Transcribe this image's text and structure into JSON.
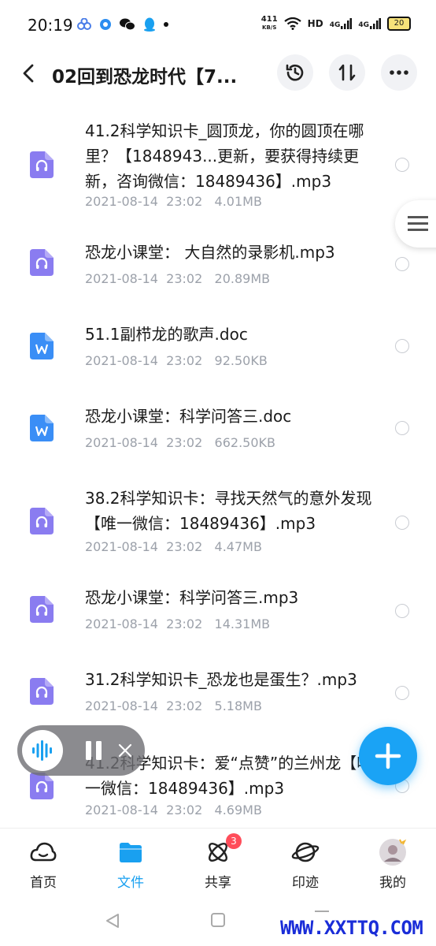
{
  "status_bar": {
    "time": "20:19",
    "net_speed_value": "411",
    "net_speed_unit": "KB/S",
    "hd_label": "HD",
    "signal1": "4G",
    "signal2": "4G",
    "battery": "20"
  },
  "header": {
    "title": "02回到恐龙时代【7..."
  },
  "files": [
    {
      "name": "41.2科学知识卡_圆顶龙，你的圆顶在哪里？【1848943...更新，要获得持续更新，咨询微信：18489436】.mp3",
      "meta": "2021-08-14  23:02   4.01MB",
      "type": "audio"
    },
    {
      "name": "恐龙小课堂： 大自然的录影机.mp3",
      "meta": "2021-08-14  23:02   20.89MB",
      "type": "audio"
    },
    {
      "name": "51.1副栉龙的歌声.doc",
      "meta": "2021-08-14  23:02   92.50KB",
      "type": "doc"
    },
    {
      "name": "恐龙小课堂：科学问答三.doc",
      "meta": "2021-08-14  23:02   662.50KB",
      "type": "doc"
    },
    {
      "name": "38.2科学知识卡：寻找天然气的意外发现【唯一微信：18489436】.mp3",
      "meta": "2021-08-14  23:02   4.47MB",
      "type": "audio"
    },
    {
      "name": "恐龙小课堂：科学问答三.mp3",
      "meta": "2021-08-14  23:02   14.31MB",
      "type": "audio"
    },
    {
      "name": "31.2科学知识卡_恐龙也是蛋生？.mp3",
      "meta": "2021-08-14  23:02   5.18MB",
      "type": "audio"
    },
    {
      "name": "41.2科学知识卡：爱“点赞”的兰州龙【唯一微信：18489436】.mp3",
      "meta": "2021-08-14  23:02   4.69MB",
      "type": "audio"
    }
  ],
  "tabs": [
    {
      "label": "首页"
    },
    {
      "label": "文件"
    },
    {
      "label": "共享",
      "badge": "3"
    },
    {
      "label": "印迹"
    },
    {
      "label": "我的"
    }
  ],
  "active_tab": "文件",
  "colors": {
    "accent": "#19a0f0",
    "audio_icon": "#8a7cf0",
    "doc_icon": "#3a8ef6",
    "badge": "#ff4d5a"
  },
  "watermark": "WWW.XXTTQ.COM"
}
